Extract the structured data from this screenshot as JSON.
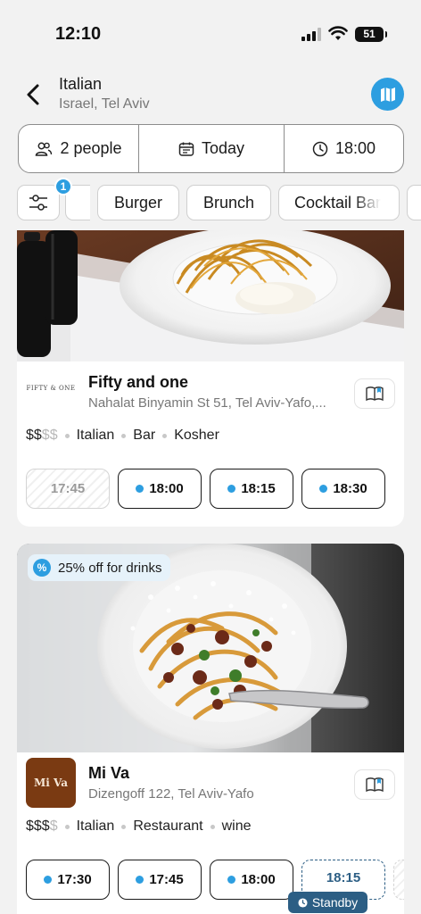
{
  "status_bar": {
    "time": "12:10",
    "battery": "51"
  },
  "header": {
    "title": "Italian",
    "subtitle": "Israel, Tel Aviv"
  },
  "booking": {
    "people": "2 people",
    "date": "Today",
    "time": "18:00"
  },
  "filters": {
    "active_count": "1",
    "chips": [
      "Burger",
      "Brunch",
      "Cocktail Bar"
    ]
  },
  "restaurants": [
    {
      "name": "Fifty and one",
      "logo_text": "FIFTY & ONE",
      "address": "Nahalat Binyamin St 51, Tel Aviv-Yafo,...",
      "price_strong": "$$",
      "price_dim": "$$",
      "tags": [
        "Italian",
        "Bar",
        "Kosher"
      ],
      "slots": [
        {
          "time": "17:45",
          "state": "unavailable"
        },
        {
          "time": "18:00",
          "state": "available"
        },
        {
          "time": "18:15",
          "state": "available"
        },
        {
          "time": "18:30",
          "state": "available"
        }
      ]
    },
    {
      "name": "Mi Va",
      "logo_text": "Mi Va",
      "promo": "25% off for drinks",
      "promo_icon": "%",
      "address": "Dizengoff 122, Tel Aviv-Yafo",
      "price_strong": "$$$",
      "price_dim": "$",
      "tags": [
        "Italian",
        "Restaurant",
        "wine"
      ],
      "slots": [
        {
          "time": "17:30",
          "state": "available"
        },
        {
          "time": "17:45",
          "state": "available"
        },
        {
          "time": "18:00",
          "state": "available"
        },
        {
          "time": "18:15",
          "state": "standby"
        }
      ],
      "standby_label": "Standby"
    }
  ],
  "colors": {
    "accent": "#2d9ee0",
    "standby": "#2c5e84",
    "logo_brown": "#7a3a12"
  },
  "icons": [
    "back-arrow-icon",
    "map-icon",
    "people-icon",
    "calendar-icon",
    "clock-icon",
    "filter-sliders-icon",
    "menu-book-icon",
    "percent-icon"
  ]
}
